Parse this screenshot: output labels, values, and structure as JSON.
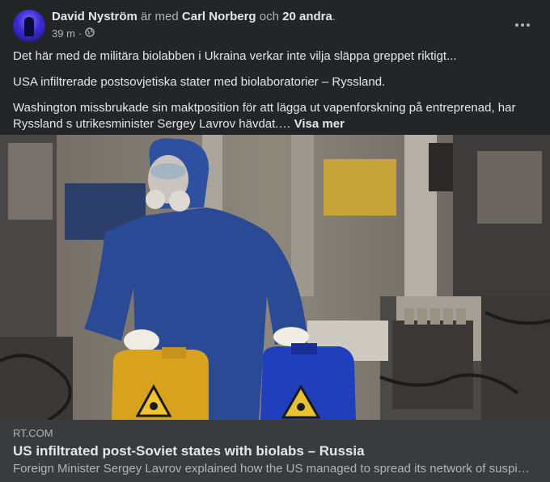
{
  "post": {
    "author": "David Nyström",
    "with_text": "är med",
    "tagged": "Carl Norberg",
    "and_text": "och",
    "others": "20 andra",
    "period": ".",
    "time": "39 m",
    "dot": "·",
    "privacy_icon": "globe-icon",
    "more_icon": "more-horizontal-icon",
    "paragraphs": [
      "Det här med de militära biolabben i Ukraina verkar inte vilja släppa greppet riktigt...",
      "USA infiltrerade postsovjetiska stater med biolaboratorier – Ryssland.",
      "Washington missbrukade sin maktposition för att lägga ut vapenforskning på entreprenad, har Ryssland s utrikesminister Sergey Lavrov hävdat.…"
    ],
    "see_more": "Visa mer"
  },
  "link": {
    "domain": "RT.COM",
    "title": "US infiltrated post-Soviet states with biolabs – Russia",
    "description": "Foreign Minister Sergey Lavrov explained how the US managed to spread its network of suspicious biolabs"
  },
  "colors": {
    "background": "#242526",
    "link_bar": "#3a3b3c",
    "text": "#e4e6eb",
    "muted": "#b0b3b8"
  }
}
